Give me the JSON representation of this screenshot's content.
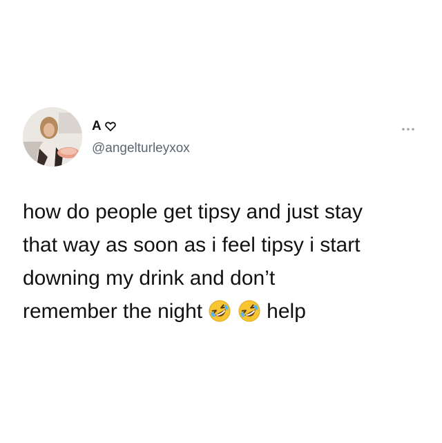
{
  "tweet": {
    "author": {
      "display_name": "A",
      "badge_icon": "heart-outline-icon",
      "handle": "@angelturleyxox",
      "avatar": "profile-photo"
    },
    "more_icon": "more-options-icon",
    "text_lines": [
      "how do people get tipsy and just stay",
      "that way as soon as i feel tipsy i start",
      "downing my drink and don’t",
      "remember the night"
    ],
    "last_line_suffix": "help",
    "emoji": [
      "rolling-on-floor-laughing-emoji",
      "rolling-on-floor-laughing-emoji"
    ],
    "colors": {
      "text": "#111111",
      "handle": "#5b6670",
      "emoji_face": "#f7c531"
    }
  }
}
